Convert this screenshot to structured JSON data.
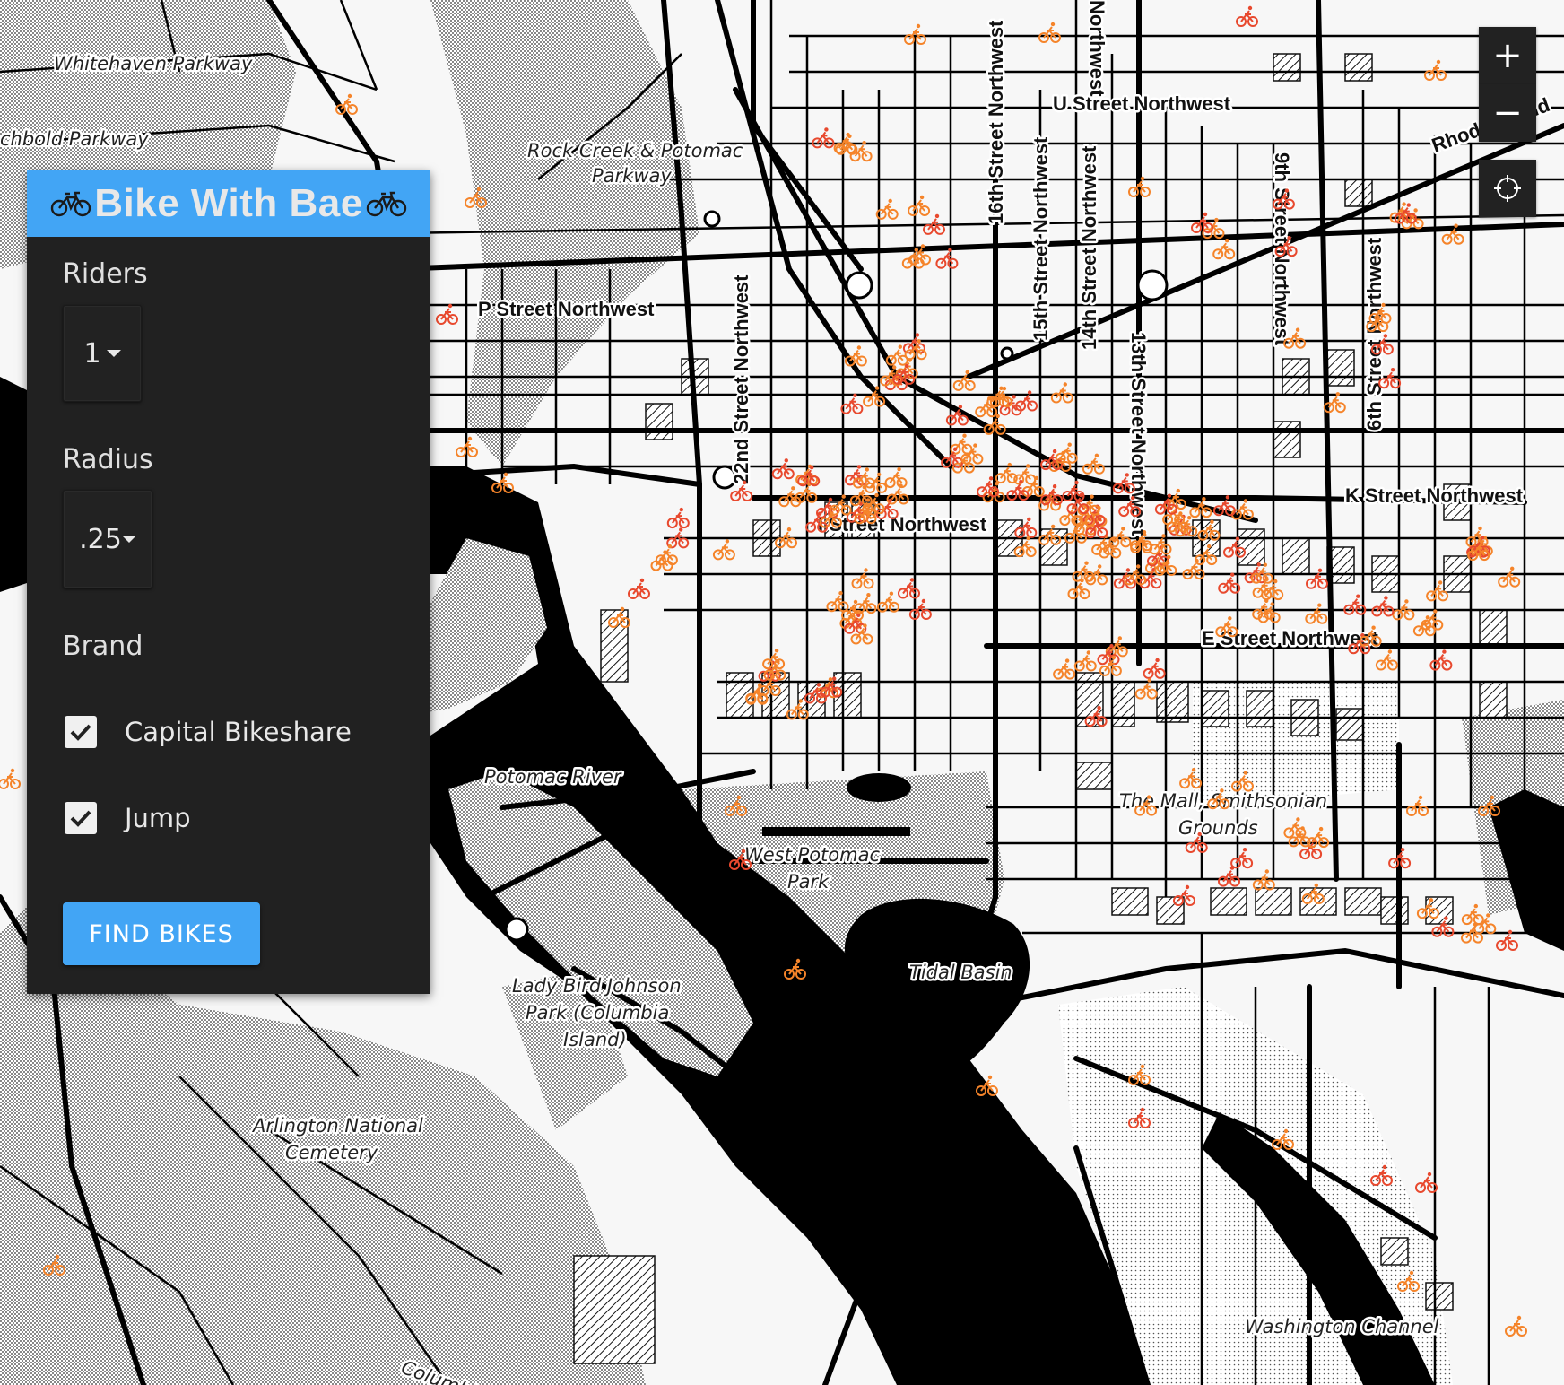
{
  "app": {
    "title": "Bike With Bae"
  },
  "panel": {
    "riders_label": "Riders",
    "riders_value": "1",
    "radius_label": "Radius",
    "radius_value": ".25",
    "brand_label": "Brand",
    "brands": [
      {
        "label": "Capital Bikeshare",
        "checked": true
      },
      {
        "label": "Jump",
        "checked": true
      }
    ],
    "find_button": "FIND BIKES"
  },
  "map": {
    "place_labels": [
      "Whitehaven Parkway",
      "chbold Parkway",
      "Rock Creek & Potomac",
      "Parkway",
      "Potomac River",
      "West Potomac",
      "Park",
      "Tidal Basin",
      "Lady Bird Johnson",
      "Park (Columbia",
      "Island)",
      "Arlington National",
      "Cemetery",
      "The Mall, Smithsonian",
      "Grounds",
      "Washington Channel",
      "Columbia Pike"
    ],
    "street_labels": [
      "P Street Northwest",
      "U Street Northwest",
      "K Street Northwest",
      "I Street Northwest",
      "E Street Northwest",
      "22nd Street Northwest",
      "16th Street Northwest",
      "15th Street Northwest",
      "14th Street Northwest",
      "13th Street Northwest",
      "9th Street Northwest",
      "6th Street Northwest",
      "Northwest",
      "Rhode Island"
    ],
    "controls": {
      "zoom_in": "+",
      "zoom_out": "−"
    },
    "colors": {
      "bike_marker_capital": "#e8492e",
      "bike_marker_jump": "#f5842a",
      "water": "#000000",
      "panel_header": "#42a5f5"
    }
  }
}
